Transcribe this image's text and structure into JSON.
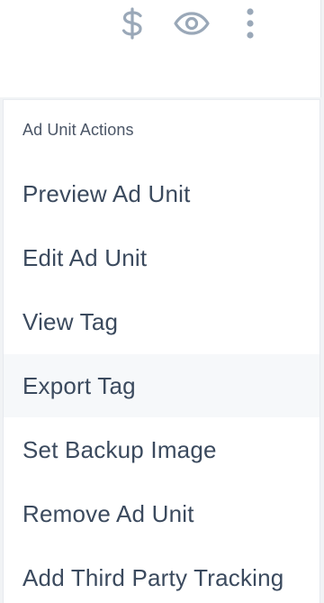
{
  "toolbar": {
    "icons": [
      "dollar-icon",
      "eye-icon",
      "more-vertical-icon"
    ],
    "icon_color": "#9aa8b8"
  },
  "menu": {
    "header": "Ad Unit Actions",
    "items": [
      {
        "label": "Preview Ad Unit"
      },
      {
        "label": "Edit Ad Unit"
      },
      {
        "label": "View Tag"
      },
      {
        "label": "Export Tag",
        "hovered": true
      },
      {
        "label": "Set Backup Image"
      },
      {
        "label": "Remove Ad Unit"
      },
      {
        "label": "Add Third Party Tracking"
      }
    ],
    "text_color": "#3b4a5e",
    "hover_color": "#f6f8fa"
  }
}
